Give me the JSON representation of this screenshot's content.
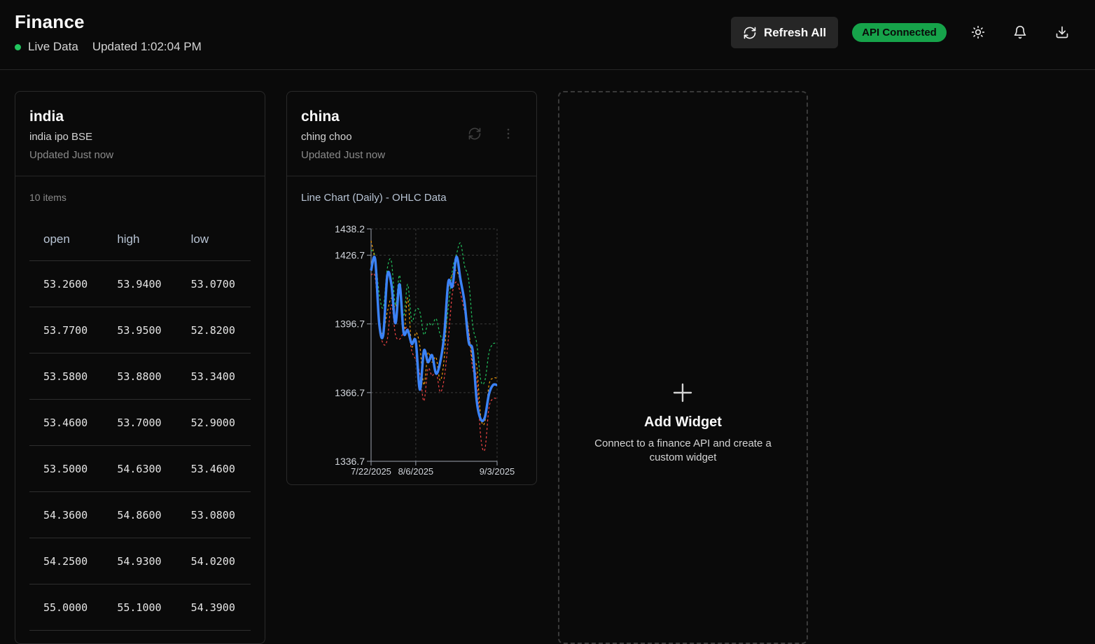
{
  "header": {
    "title": "Finance",
    "live_label": "Live Data",
    "updated": "Updated 1:02:04 PM",
    "refresh_label": "Refresh All",
    "api_status": "API Connected"
  },
  "widgets": [
    {
      "title": "india",
      "subtitle": "india ipo BSE",
      "updated": "Updated Just now",
      "items_count": "10 items",
      "columns": [
        "open",
        "high",
        "low"
      ],
      "rows": [
        [
          "53.2600",
          "53.9400",
          "53.0700"
        ],
        [
          "53.7700",
          "53.9500",
          "52.8200"
        ],
        [
          "53.5800",
          "53.8800",
          "53.3400"
        ],
        [
          "53.4600",
          "53.7000",
          "52.9000"
        ],
        [
          "53.5000",
          "54.6300",
          "53.4600"
        ],
        [
          "54.3600",
          "54.8600",
          "53.0800"
        ],
        [
          "54.2500",
          "54.9300",
          "54.0200"
        ],
        [
          "55.0000",
          "55.1000",
          "54.3900"
        ]
      ]
    },
    {
      "title": "china",
      "subtitle": "ching choo",
      "updated": "Updated Just now",
      "chart_title": "Line Chart (Daily) - OHLC Data"
    }
  ],
  "add_widget": {
    "title": "Add Widget",
    "description": "Connect to a finance API and create a custom widget"
  },
  "colors": {
    "accent_green": "#16a34a",
    "live_dot": "#22c55e",
    "close_line": "#3b82f6",
    "high_line": "#22c55e",
    "low_line": "#ef4444",
    "open_line": "#f59e0b"
  },
  "icons": [
    "refresh-icon",
    "sun-icon",
    "bell-icon",
    "download-icon",
    "more-vertical-icon",
    "plus-icon"
  ],
  "chart_data": {
    "type": "line",
    "title": "",
    "xlabel": "",
    "ylabel": "",
    "ylim": [
      1336.7,
      1438.2
    ],
    "yticks": [
      1336.7,
      1366.7,
      1396.7,
      1426.7,
      1438.2
    ],
    "xticks": [
      "7/22/2025",
      "8/6/2025",
      "9/3/2025"
    ],
    "x": [
      "7/22/2025",
      "7/23/2025",
      "7/24/2025",
      "7/25/2025",
      "7/28/2025",
      "7/29/2025",
      "7/30/2025",
      "7/31/2025",
      "8/1/2025",
      "8/4/2025",
      "8/5/2025",
      "8/6/2025",
      "8/7/2025",
      "8/8/2025",
      "8/11/2025",
      "8/12/2025",
      "8/13/2025",
      "8/14/2025",
      "8/15/2025",
      "8/18/2025",
      "8/19/2025",
      "8/20/2025",
      "8/21/2025",
      "8/22/2025",
      "8/25/2025",
      "8/26/2025",
      "8/27/2025",
      "8/28/2025",
      "8/29/2025",
      "9/1/2025",
      "9/2/2025",
      "9/3/2025"
    ],
    "grid": true,
    "series": [
      {
        "name": "",
        "color": "#22c55e",
        "style": "dashed",
        "values": [
          1429,
          1426,
          1410,
          1404,
          1421,
          1424,
          1405,
          1418,
          1400,
          1414,
          1398,
          1403,
          1402,
          1392,
          1397,
          1396,
          1399,
          1392,
          1390,
          1404,
          1420,
          1427,
          1432,
          1422,
          1416,
          1396,
          1388,
          1372,
          1372,
          1384,
          1388,
          1388
        ]
      },
      {
        "name": "",
        "color": "#ef4444",
        "style": "dashed",
        "values": [
          1418,
          1417,
          1396,
          1388,
          1390,
          1405,
          1392,
          1390,
          1393,
          1395,
          1385,
          1381,
          1375,
          1363,
          1377,
          1374,
          1376,
          1367,
          1373,
          1390,
          1410,
          1415,
          1410,
          1402,
          1394,
          1377,
          1373,
          1347,
          1342,
          1360,
          1364,
          1364
        ]
      },
      {
        "name": "",
        "color": "#f59e0b",
        "style": "dashed",
        "values": [
          1433,
          1423,
          1397,
          1393,
          1402,
          1408,
          1404,
          1413,
          1392,
          1408,
          1387,
          1393,
          1387,
          1370,
          1384,
          1380,
          1382,
          1372,
          1382,
          1411,
          1418,
          1420,
          1415,
          1406,
          1394,
          1380,
          1378,
          1356,
          1354,
          1370,
          1373,
          1373
        ]
      },
      {
        "name": "",
        "color": "#3b82f6",
        "style": "solid",
        "values": [
          1420,
          1425,
          1397,
          1392,
          1418,
          1414,
          1397,
          1414,
          1393,
          1394,
          1388,
          1389,
          1368,
          1385,
          1380,
          1383,
          1375,
          1380,
          1392,
          1415,
          1413,
          1426,
          1416,
          1406,
          1389,
          1385,
          1363,
          1355,
          1356,
          1366,
          1370,
          1370
        ]
      }
    ]
  }
}
